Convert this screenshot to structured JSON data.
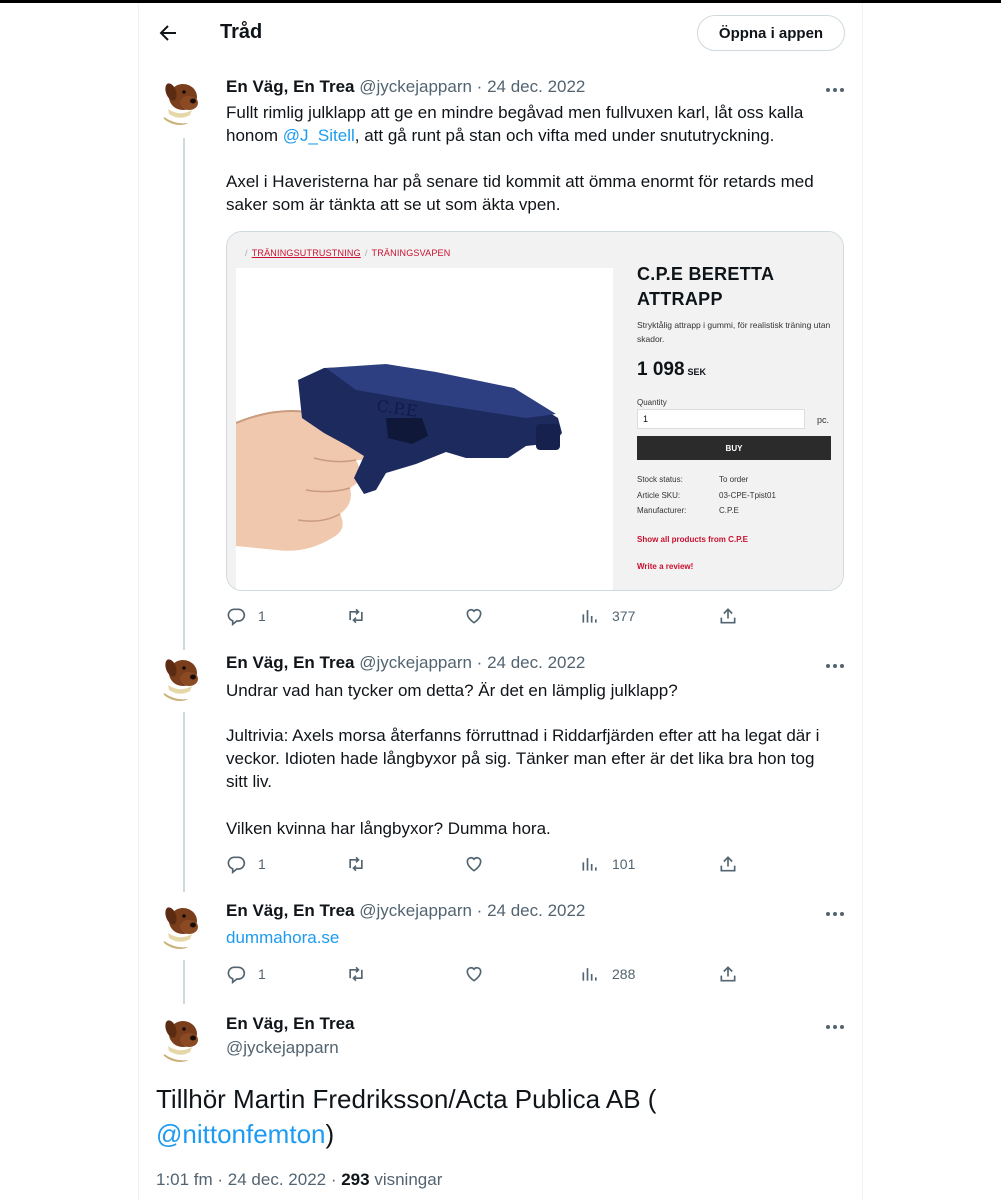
{
  "header": {
    "title": "Tråd",
    "open_app_label": "Öppna i appen"
  },
  "tweets": [
    {
      "name": "En Väg, En Trea",
      "handle": "@jyckejapparn",
      "separator": "·",
      "date": "24 dec. 2022",
      "text_part1": "Fullt rimlig julklapp att ge en mindre begåvad men fullvuxen karl, låt oss kalla honom ",
      "mention": "@J_Sitell",
      "text_part2": ", att gå runt på stan och vifta med under snututryckning.",
      "text_para2": "Axel i Haveristerna har på senare tid kommit att ömma enormt för retards med saker som är tänkta att se ut som äkta vpen.",
      "replies": "1",
      "views": "377"
    },
    {
      "name": "En Väg, En Trea",
      "handle": "@jyckejapparn",
      "separator": "·",
      "date": "24 dec. 2022",
      "para1": "Undrar vad han tycker om detta? Är det en lämplig julklapp?",
      "para2": "Jultrivia: Axels morsa återfanns förruttnad i Riddarfjärden efter att ha legat där i veckor. Idioten hade långbyxor på sig. Tänker man efter är det lika bra hon tog sitt liv.",
      "para3": "Vilken kvinna har långbyxor? Dumma hora.",
      "replies": "1",
      "views": "101"
    },
    {
      "name": "En Väg, En Trea",
      "handle": "@jyckejapparn",
      "separator": "·",
      "date": "24 dec. 2022",
      "link": "dummahora.se",
      "replies": "1",
      "views": "288"
    }
  ],
  "main_tweet": {
    "name": "En Väg, En Trea",
    "handle": "@jyckejapparn",
    "text_part1": "Tillhör Martin Fredriksson/Acta Publica AB (",
    "mention": "@nittonfemton",
    "text_part2": ")",
    "time": "1:01 fm · 24 dec. 2022 · ",
    "views_count": "293",
    "views_label": " visningar"
  },
  "product_card": {
    "crumb1": "TRÄNINGSUTRUSTNING",
    "crumb2": "TRÄNINGSVAPEN",
    "title_line1": "C.P.E BERETTA",
    "title_line2": "ATTRAPP",
    "description": "Stryktålig attrapp i gummi, för realistisk träning utan skador.",
    "price": "1 098",
    "currency": "SEK",
    "quantity_label": "Quantity",
    "quantity_value": "1",
    "unit": "pc.",
    "buy_label": "BUY",
    "spec_labels": [
      "Stock status:",
      "Article SKU:",
      "Manufacturer:"
    ],
    "spec_values": [
      "To order",
      "03-CPE-Tpist01",
      "C.P.E"
    ],
    "show_all": "Show all products from C.P.E",
    "write_review": "Write a review!",
    "gun_stamp": "C.P.E"
  },
  "colors": {
    "accent": "#1d9bf0",
    "muted": "#536471",
    "text": "#0f1419",
    "border": "#cfd9de",
    "shop_red": "#c8102e"
  },
  "icons": [
    "back-arrow-icon",
    "more-icon",
    "reply-icon",
    "retweet-icon",
    "like-icon",
    "views-icon",
    "share-icon"
  ]
}
